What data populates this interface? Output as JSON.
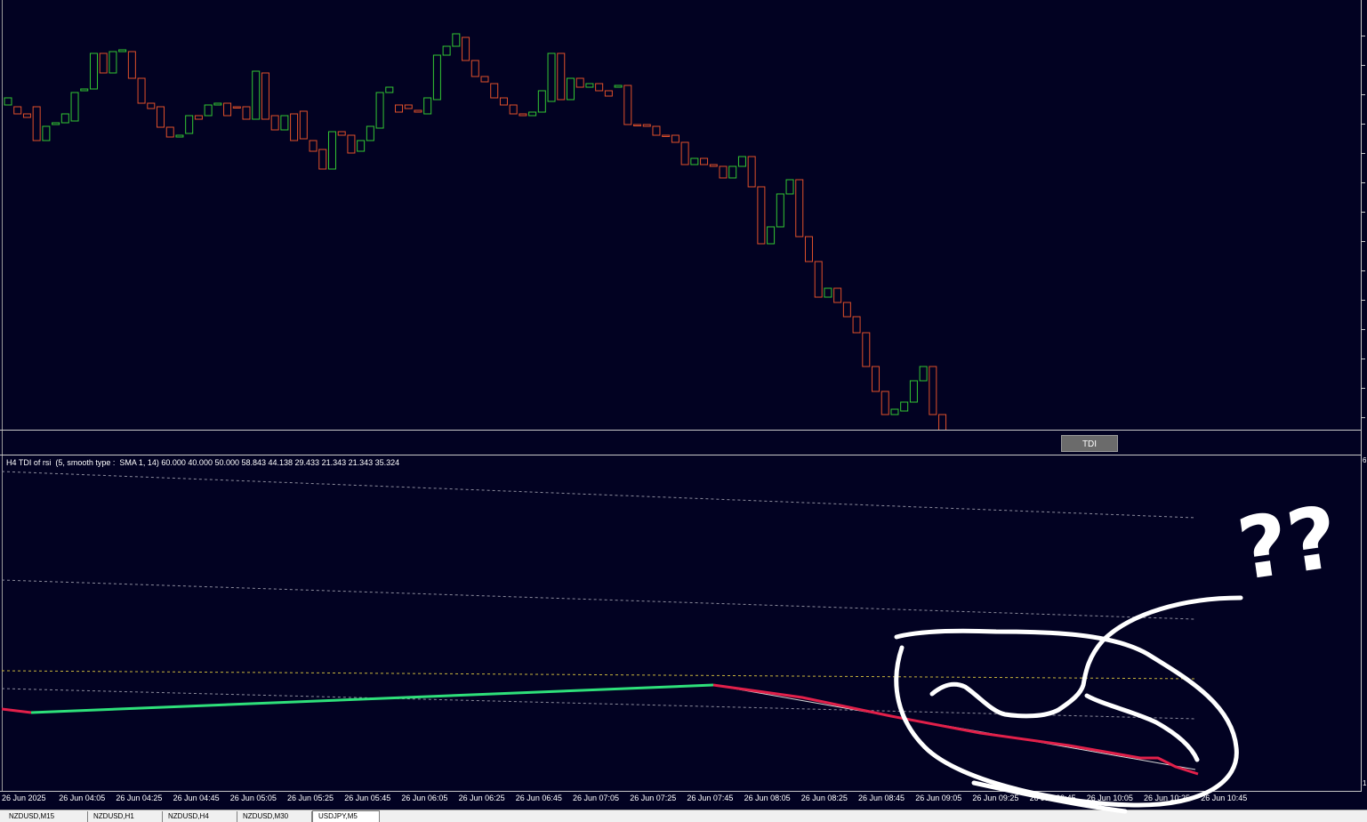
{
  "main_chart": {
    "up_color": "#33c733",
    "down_color": "#e0502a",
    "background": "#020222",
    "candles": [
      [
        118,
        132,
        102,
        110
      ],
      [
        120,
        132,
        100,
        128
      ],
      [
        128,
        160,
        115,
        132
      ],
      [
        120,
        165,
        97,
        158
      ],
      [
        158,
        160,
        122,
        142
      ],
      [
        140,
        150,
        112,
        138
      ],
      [
        138,
        142,
        110,
        128
      ],
      [
        136,
        142,
        108,
        104
      ],
      [
        102,
        110,
        87,
        100
      ],
      [
        100,
        110,
        60,
        60
      ],
      [
        60,
        80,
        38,
        82
      ],
      [
        82,
        88,
        57,
        58
      ],
      [
        58,
        60,
        40,
        56
      ],
      [
        58,
        90,
        58,
        88
      ],
      [
        88,
        120,
        78,
        116
      ],
      [
        116,
        127,
        110,
        122
      ],
      [
        120,
        140,
        116,
        143
      ],
      [
        143,
        148,
        130,
        154
      ],
      [
        154,
        162,
        138,
        152
      ],
      [
        150,
        155,
        127,
        130
      ],
      [
        130,
        134,
        118,
        134
      ],
      [
        130,
        140,
        114,
        118
      ],
      [
        118,
        130,
        108,
        116
      ],
      [
        116,
        120,
        114,
        130
      ],
      [
        120,
        135,
        108,
        120
      ],
      [
        120,
        160,
        115,
        134
      ],
      [
        134,
        150,
        80,
        80
      ],
      [
        82,
        135,
        78,
        134
      ],
      [
        130,
        150,
        112,
        146
      ],
      [
        146,
        158,
        128,
        130
      ],
      [
        128,
        160,
        112,
        158
      ],
      [
        125,
        152,
        112,
        156
      ],
      [
        158,
        162,
        144,
        170
      ],
      [
        168,
        190,
        146,
        190
      ],
      [
        190,
        222,
        166,
        148
      ],
      [
        148,
        172,
        126,
        152
      ],
      [
        152,
        168,
        146,
        172
      ],
      [
        170,
        176,
        148,
        158
      ],
      [
        158,
        170,
        150,
        142
      ],
      [
        144,
        160,
        140,
        104
      ],
      [
        104,
        112,
        96,
        98
      ],
      [
        118,
        126,
        100,
        126
      ],
      [
        118,
        125,
        112,
        122
      ],
      [
        124,
        125,
        120,
        126
      ],
      [
        128,
        132,
        110,
        110
      ],
      [
        112,
        118,
        88,
        62
      ],
      [
        62,
        65,
        40,
        52
      ],
      [
        52,
        55,
        38,
        38
      ],
      [
        42,
        58,
        42,
        68
      ],
      [
        68,
        82,
        57,
        86
      ],
      [
        86,
        92,
        80,
        92
      ],
      [
        94,
        110,
        88,
        110
      ],
      [
        110,
        115,
        100,
        118
      ],
      [
        118,
        120,
        115,
        128
      ],
      [
        128,
        130,
        104,
        130
      ],
      [
        130,
        132,
        105,
        126
      ],
      [
        126,
        128,
        120,
        102
      ],
      [
        114,
        116,
        102,
        60
      ],
      [
        60,
        70,
        56,
        112
      ],
      [
        112,
        116,
        85,
        88
      ],
      [
        88,
        100,
        84,
        98
      ],
      [
        98,
        100,
        90,
        94
      ],
      [
        94,
        106,
        88,
        102
      ],
      [
        102,
        112,
        98,
        108
      ],
      [
        98,
        118,
        98,
        96
      ],
      [
        96,
        120,
        87,
        140
      ],
      [
        140,
        142,
        128,
        140
      ],
      [
        140,
        148,
        132,
        142
      ],
      [
        142,
        144,
        132,
        152
      ],
      [
        152,
        155,
        128,
        152
      ],
      [
        152,
        153,
        140,
        160
      ],
      [
        160,
        161,
        120,
        185
      ],
      [
        185,
        190,
        170,
        178
      ],
      [
        178,
        182,
        145,
        185
      ],
      [
        185,
        190,
        145,
        187
      ],
      [
        187,
        190,
        120,
        200
      ],
      [
        200,
        210,
        150,
        187
      ],
      [
        187,
        195,
        170,
        176
      ],
      [
        176,
        180,
        152,
        210
      ],
      [
        210,
        316,
        190,
        274
      ],
      [
        274,
        278,
        230,
        255
      ],
      [
        255,
        258,
        215,
        218
      ],
      [
        218,
        224,
        192,
        202
      ],
      [
        202,
        210,
        196,
        266
      ],
      [
        266,
        294,
        248,
        294
      ],
      [
        294,
        354,
        290,
        334
      ],
      [
        334,
        344,
        310,
        324
      ],
      [
        324,
        346,
        310,
        340
      ],
      [
        340,
        356,
        312,
        356
      ],
      [
        356,
        376,
        328,
        374
      ],
      [
        374,
        394,
        358,
        412
      ],
      [
        412,
        418,
        404,
        440
      ],
      [
        440,
        452,
        420,
        466
      ],
      [
        466,
        498,
        450,
        460
      ],
      [
        462,
        468,
        450,
        452
      ],
      [
        452,
        462,
        434,
        428
      ],
      [
        428,
        468,
        420,
        412
      ],
      [
        412,
        420,
        398,
        466
      ],
      [
        466,
        490,
        460,
        484
      ]
    ]
  },
  "tdi_button_label": "TDI",
  "indicator": {
    "caption": "H4 TDI of rsi  (5, smooth type :  SMA 1, 14) 60.000 40.000 50.000 58.843 44.138 29.433 21.343 21.343 35.324",
    "scale_top": "6",
    "scale_bottom": "1",
    "up_line_color": "#2ee07a",
    "down_line_color": "#e2204a",
    "band_color": "#8c8c9c",
    "mid_level_color": "#c8b43c"
  },
  "time_axis": {
    "labels": [
      "26 Jun 2025",
      "26 Jun 04:05",
      "26 Jun 04:25",
      "26 Jun 04:45",
      "26 Jun 05:05",
      "26 Jun 05:25",
      "26 Jun 05:45",
      "26 Jun 06:05",
      "26 Jun 06:25",
      "26 Jun 06:45",
      "26 Jun 07:05",
      "26 Jun 07:25",
      "26 Jun 07:45",
      "26 Jun 08:05",
      "26 Jun 08:25",
      "26 Jun 08:45",
      "26 Jun 09:05",
      "26 Jun 09:25",
      "26 Jun 09:45",
      "26 Jun 10:05",
      "26 Jun 10:25",
      "26 Jun 10:45"
    ]
  },
  "symbol_tabs": [
    "NZDUSD,M15",
    "NZDUSD,H1",
    "NZDUSD,H4",
    "NZDUSD,M30",
    "USDJPY,M5"
  ],
  "annotation_text": "??",
  "annotation_color": "#ffffff"
}
